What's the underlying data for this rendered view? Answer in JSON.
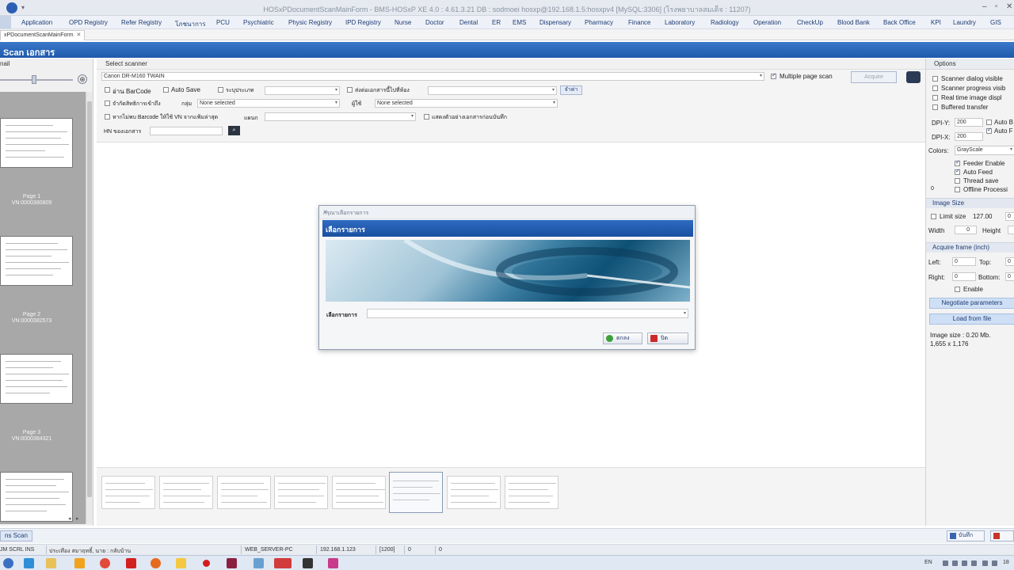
{
  "window": {
    "title": "HOSxPDocumentScanMainForm - BMS-HOSxP XE 4.0 : 4.61.3.21 DB : sodmoei hosxp@192.168.1.5:hosxpv4 [MySQL:3306] (โรงพยาบาลสมเด็จ : 11207)"
  },
  "menu": [
    "Application",
    "OPD Registry",
    "Refer Registry",
    "โภชนาการ",
    "PCU",
    "Psychiatric",
    "Physic Registry",
    "IPD Registry",
    "Nurse",
    "Doctor",
    "Dental",
    "ER",
    "EMS",
    "Dispensary",
    "Pharmacy",
    "Finance",
    "Laboratory",
    "Radiology",
    "Operation",
    "CheckUp",
    "Blood Bank",
    "Back Office",
    "KPI",
    "Laundry",
    "GIS"
  ],
  "doc_tab": {
    "label": "xPDocumentScanMainForm",
    "close": "✕"
  },
  "page_title": "Scan เอกสาร",
  "thumbnail_panel": {
    "header": "nail",
    "zoom_symbol": "⊕",
    "pages": [
      {
        "label": "Page 1",
        "vn": "VN:0000380809"
      },
      {
        "label": "Page 2",
        "vn": "VN:0000382573"
      },
      {
        "label": "Page 3",
        "vn": "VN:0000384321"
      }
    ]
  },
  "scanner": {
    "header": "Select scanner",
    "selected": "Canon DR-M160 TWAIN",
    "multiple_page_scan_label": "Multiple page scan",
    "multiple_page_scan": true,
    "acquire_label": "Acquire"
  },
  "form": {
    "read_barcode": "อ่าน BarCode",
    "auto_save": "Auto Save",
    "specify_date": "ระบุประเภท",
    "send_to_room": "ส่งต่อเอกสารนี้ไปที่ห้อง",
    "confirm_button": "จำค่า",
    "set_rights": "จำกัดสิทธิการเข้าถึง",
    "group_label": "กลุ่ม",
    "group_value": "None selected",
    "user_label": "ผู้ใช้",
    "user_value": "None selected",
    "no_barcode_vn": "หากไม่พบ Barcode ให้ใช้ VN จากแฟ้มล่าสุด",
    "dept_label": "แผนก",
    "show_sample": "แสดงตัวอย่างเอกสารก่อนบันทึก",
    "hn_label": "HN ของเอกสาร"
  },
  "options": {
    "header": "Options",
    "checks": [
      {
        "label": "Scanner dialog visible",
        "checked": false
      },
      {
        "label": "Scanner progress visib",
        "checked": false
      },
      {
        "label": "Real time image displ",
        "checked": false
      },
      {
        "label": "Buffered transfer",
        "checked": false
      }
    ],
    "dpi_y_label": "DPI-Y:",
    "dpi_y": "200",
    "dpi_x_label": "DPI-X:",
    "dpi_x": "200",
    "auto_b": "Auto B",
    "auto_f": "Auto F",
    "colors_label": "Colors:",
    "colors_value": "GrayScale",
    "feeder_enabled": "Feeder Enable",
    "auto_feed": "Auto Feed",
    "thread_save": "Thread save",
    "offline_processing": "Offline Processi",
    "zero": "0",
    "image_size_header": "Image Size",
    "limit_size_label": "Limit size",
    "limit_size_value": "127.00",
    "limit_extra": "0",
    "width_label": "Width",
    "width_value": "0",
    "height_label": "Height",
    "acquire_frame_header": "Acquire frame (inch)",
    "left_label": "Left:",
    "left_value": "0",
    "top_label": "Top:",
    "top_value": "0",
    "right_label": "Right:",
    "right_value": "0",
    "bottom_label": "Bottom:",
    "bottom_value": "0",
    "enable_label": "Enable",
    "negotiate_button": "Negotiate parameters",
    "load_from_file_button": "Load from file",
    "image_info_line1": "Image size : 0.20 Mb.",
    "image_info_line2": "1,655 x 1,176"
  },
  "dialog": {
    "title": "กรุณาเลือกรายการ",
    "header": "เลือกรายการ",
    "field_label": "เลือกรายการ",
    "field_value": "",
    "ok_label": "ตกลง",
    "close_label": "ปิด"
  },
  "bottombar": {
    "left_button": "ns Scan",
    "save_button": "บันทึก"
  },
  "statusbar": {
    "left": "JM  SCRL  INS",
    "user": "ประเทือง  สมาฤทธิ์, นาย : กลับบ้าน",
    "server": "WEB_SERVER-PC",
    "ip": "192.168.1.123",
    "code": "[1200]",
    "n1": "0",
    "n2": "0"
  },
  "taskbar": {
    "lang": "EN",
    "clock": "18"
  },
  "colors": {
    "accent": "#1f5aab",
    "menu_text": "#1f3c74"
  }
}
